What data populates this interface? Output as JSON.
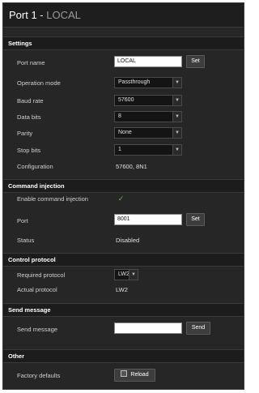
{
  "title": {
    "port": "Port 1 - ",
    "name": "LOCAL"
  },
  "settings": {
    "header": "Settings",
    "port_name": {
      "label": "Port name",
      "value": "LOCAL",
      "button": "Set"
    },
    "operation_mode": {
      "label": "Operation mode",
      "value": "Passthrough"
    },
    "baud_rate": {
      "label": "Baud rate",
      "value": "57600"
    },
    "data_bits": {
      "label": "Data bits",
      "value": "8"
    },
    "parity": {
      "label": "Parity",
      "value": "None"
    },
    "stop_bits": {
      "label": "Stop bits",
      "value": "1"
    },
    "configuration": {
      "label": "Configuration",
      "value": "57600, 8N1"
    }
  },
  "command_injection": {
    "header": "Command injection",
    "enable": {
      "label": "Enable command injection",
      "checked": true
    },
    "port": {
      "label": "Port",
      "value": "8001",
      "button": "Set"
    },
    "status": {
      "label": "Status",
      "value": "Disabled"
    }
  },
  "control_protocol": {
    "header": "Control protocol",
    "required": {
      "label": "Required protocol",
      "value": "LW2"
    },
    "actual": {
      "label": "Actual protocol",
      "value": "LW2"
    }
  },
  "send_message": {
    "header": "Send message",
    "message": {
      "label": "Send message",
      "value": "",
      "button": "Send"
    }
  },
  "other": {
    "header": "Other",
    "factory": {
      "label": "Factory defaults",
      "button": "Reload"
    }
  },
  "icons": {
    "check": "check-icon",
    "reload": "reload-icon",
    "dropdown": "chevron-down-icon"
  },
  "colors": {
    "background": "#262626",
    "header": "#1c1c1c",
    "check": "#5fb836"
  }
}
